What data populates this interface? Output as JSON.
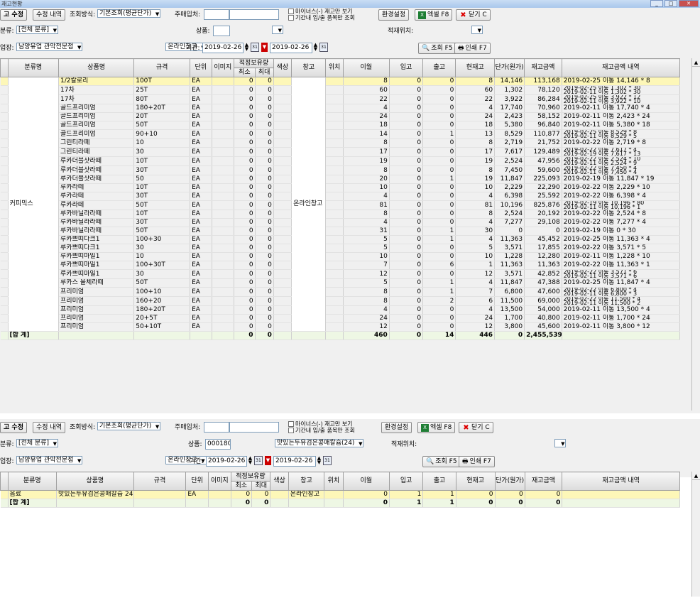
{
  "w1": {
    "title": "재고현황",
    "toolbar": {
      "stock_edit_label": "고 수정",
      "edit_history_label": "수정 내역",
      "query_method_label": "조회방식:",
      "query_method_value": "기본조회(평균단가)",
      "supplier_label": "주매입처:",
      "minus_only_label": "마이너스(-) 재고만 보기",
      "period_io_label": "기간내 입/출 품목만 조회",
      "settings_label": "환경설정",
      "excel_label": "엑셀 F8",
      "close_label": "닫기 C"
    },
    "filter1": {
      "category_label": "분류:",
      "category_value": "[전체 분류]",
      "product_label": "상품:",
      "product_code": "",
      "product_name": "",
      "location_label": "적재위치:",
      "location_value": ""
    },
    "filter2": {
      "store_label": "업장:",
      "store_value": "남양유업 관악전문점",
      "warehouse_value": "온라인창고",
      "period_label": "기간:",
      "date_from": "2019-02-26",
      "date_to": "2019-02-26",
      "search_label": "조회 F5",
      "print_label": "인쇄 F7"
    },
    "columns": [
      "분류명",
      "상품명",
      "규격",
      "단위",
      "이미지",
      "적정보유량",
      "최소",
      "최대",
      "색상",
      "창고",
      "위치",
      "이월",
      "입고",
      "출고",
      "현재고",
      "단가(원가)",
      "재고금액",
      "재고금액 내역"
    ],
    "group_category": "커피믹스",
    "group_warehouse": "온라인창고",
    "rows": [
      {
        "name": "1/2칼로리",
        "spec": "100T",
        "unit": "EA",
        "min": "0",
        "max": "0",
        "prev": "8",
        "in": "0",
        "out": "0",
        "cur": "8",
        "price": "14,146",
        "amount": "113,168",
        "detail": "2019-02-25 이통 14,146 * 8",
        "detail2": ""
      },
      {
        "name": "17차",
        "spec": "25T",
        "unit": "EA",
        "min": "0",
        "max": "0",
        "prev": "60",
        "in": "0",
        "out": "0",
        "cur": "60",
        "price": "1,302",
        "amount": "78,120",
        "detail": "2019-02-25 이통 1,302 * 30",
        "detail2": "2019-02-11 이통 1,302 * 30"
      },
      {
        "name": "17차",
        "spec": "80T",
        "unit": "EA",
        "min": "0",
        "max": "0",
        "prev": "22",
        "in": "0",
        "out": "0",
        "cur": "22",
        "price": "3,922",
        "amount": "86,284",
        "detail": "2019-02-25 이통 3,922 * 12",
        "detail2": "2019-02-11 이통 3,922 * 10"
      },
      {
        "name": "골드프리미엄",
        "spec": "180+20T",
        "unit": "EA",
        "min": "0",
        "max": "0",
        "prev": "4",
        "in": "0",
        "out": "0",
        "cur": "4",
        "price": "17,740",
        "amount": "70,960",
        "detail": "2019-02-11 이통 17,740 * 4",
        "detail2": ""
      },
      {
        "name": "골드프리미엄",
        "spec": "20T",
        "unit": "EA",
        "min": "0",
        "max": "0",
        "prev": "24",
        "in": "0",
        "out": "0",
        "cur": "24",
        "price": "2,423",
        "amount": "58,152",
        "detail": "2019-02-11 이통 2,423 * 24",
        "detail2": ""
      },
      {
        "name": "골드프리미엄",
        "spec": "50T",
        "unit": "EA",
        "min": "0",
        "max": "0",
        "prev": "18",
        "in": "0",
        "out": "0",
        "cur": "18",
        "price": "5,380",
        "amount": "96,840",
        "detail": "2019-02-11 이통 5,380 * 18",
        "detail2": ""
      },
      {
        "name": "골드프리미엄",
        "spec": "90+10",
        "unit": "EA",
        "min": "0",
        "max": "0",
        "prev": "14",
        "in": "0",
        "out": "1",
        "cur": "13",
        "price": "8,529",
        "amount": "110,877",
        "detail": "2019-02-25 이통 8,529 * 8",
        "detail2": "2019-02-11 이통 8,529 * 5"
      },
      {
        "name": "그린티라떼",
        "spec": "10",
        "unit": "EA",
        "min": "0",
        "max": "0",
        "prev": "8",
        "in": "0",
        "out": "0",
        "cur": "8",
        "price": "2,719",
        "amount": "21,752",
        "detail": "2019-02-22 이통 2,719 * 8",
        "detail2": ""
      },
      {
        "name": "그린티라떼",
        "spec": "30",
        "unit": "EA",
        "min": "0",
        "max": "0",
        "prev": "17",
        "in": "0",
        "out": "0",
        "cur": "17",
        "price": "7,617",
        "amount": "129,489",
        "detail": "2019-02-22 이통 7,617 * 4",
        "detail2": "2019-02-19 이통 7,617 * 13"
      },
      {
        "name": "루카더블샷라떼",
        "spec": "10T",
        "unit": "EA",
        "min": "0",
        "max": "0",
        "prev": "19",
        "in": "0",
        "out": "0",
        "cur": "19",
        "price": "2,524",
        "amount": "47,956",
        "detail": "2019-02-22 이통 2,524 * 10",
        "detail2": "2019-02-11 이통 2,524 * 9"
      },
      {
        "name": "루카더블샷라떼",
        "spec": "30T",
        "unit": "EA",
        "min": "0",
        "max": "0",
        "prev": "8",
        "in": "0",
        "out": "0",
        "cur": "8",
        "price": "7,450",
        "amount": "59,600",
        "detail": "2019-02-22 이통 7,450 * 4",
        "detail2": "2019-02-11 이통 7,450 * 4"
      },
      {
        "name": "루카더블샷라떼",
        "spec": "50",
        "unit": "EA",
        "min": "0",
        "max": "0",
        "prev": "20",
        "in": "0",
        "out": "1",
        "cur": "19",
        "price": "11,847",
        "amount": "225,093",
        "detail": "2019-02-19 이통 11,847 * 19",
        "detail2": ""
      },
      {
        "name": "루카라떼",
        "spec": "10T",
        "unit": "EA",
        "min": "0",
        "max": "0",
        "prev": "10",
        "in": "0",
        "out": "0",
        "cur": "10",
        "price": "2,229",
        "amount": "22,290",
        "detail": "2019-02-22 이통 2,229 * 10",
        "detail2": ""
      },
      {
        "name": "루카라떼",
        "spec": "30T",
        "unit": "EA",
        "min": "0",
        "max": "0",
        "prev": "4",
        "in": "0",
        "out": "0",
        "cur": "4",
        "price": "6,398",
        "amount": "25,592",
        "detail": "2019-02-22 이통 6,398 * 4",
        "detail2": ""
      },
      {
        "name": "루카라떼",
        "spec": "50T",
        "unit": "EA",
        "min": "0",
        "max": "0",
        "prev": "81",
        "in": "0",
        "out": "0",
        "cur": "81",
        "price": "10,196",
        "amount": "825,876",
        "detail": "2019-02-19 이통 10,196 * 80",
        "detail2": "2019-02-11 이통 10,196 * 1"
      },
      {
        "name": "루카바닐라라떼",
        "spec": "10T",
        "unit": "EA",
        "min": "0",
        "max": "0",
        "prev": "8",
        "in": "0",
        "out": "0",
        "cur": "8",
        "price": "2,524",
        "amount": "20,192",
        "detail": "2019-02-22 이통 2,524 * 8",
        "detail2": ""
      },
      {
        "name": "루카바닐라라떼",
        "spec": "30T",
        "unit": "EA",
        "min": "0",
        "max": "0",
        "prev": "4",
        "in": "0",
        "out": "0",
        "cur": "4",
        "price": "7,277",
        "amount": "29,108",
        "detail": "2019-02-22 이통 7,277 * 4",
        "detail2": ""
      },
      {
        "name": "루카바닐라라떼",
        "spec": "50T",
        "unit": "EA",
        "min": "0",
        "max": "0",
        "prev": "31",
        "in": "0",
        "out": "1",
        "cur": "30",
        "price": "0",
        "amount": "0",
        "detail": "2019-02-19 이통 0 * 30",
        "detail2": ""
      },
      {
        "name": "루카쁘띠다크1",
        "spec": "100+30",
        "unit": "EA",
        "min": "0",
        "max": "0",
        "prev": "5",
        "in": "0",
        "out": "1",
        "cur": "4",
        "price": "11,363",
        "amount": "45,452",
        "detail": "2019-02-25 이통 11,363 * 4",
        "detail2": ""
      },
      {
        "name": "루카쁘띠다크1",
        "spec": "30",
        "unit": "EA",
        "min": "0",
        "max": "0",
        "prev": "5",
        "in": "0",
        "out": "0",
        "cur": "5",
        "price": "3,571",
        "amount": "17,855",
        "detail": "2019-02-22 이통 3,571 * 5",
        "detail2": ""
      },
      {
        "name": "루카쁘띠마일1",
        "spec": "10",
        "unit": "EA",
        "min": "0",
        "max": "0",
        "prev": "10",
        "in": "0",
        "out": "0",
        "cur": "10",
        "price": "1,228",
        "amount": "12,280",
        "detail": "2019-02-11 이통 1,228 * 10",
        "detail2": ""
      },
      {
        "name": "루카쁘띠마일1",
        "spec": "100+30T",
        "unit": "EA",
        "min": "0",
        "max": "0",
        "prev": "7",
        "in": "0",
        "out": "6",
        "cur": "1",
        "price": "11,363",
        "amount": "11,363",
        "detail": "2019-02-22 이통 11,363 * 1",
        "detail2": ""
      },
      {
        "name": "루카쁘띠마일1",
        "spec": "30",
        "unit": "EA",
        "min": "0",
        "max": "0",
        "prev": "12",
        "in": "0",
        "out": "0",
        "cur": "12",
        "price": "3,571",
        "amount": "42,852",
        "detail": "2019-02-22 이통 3,571 * 6",
        "detail2": "2019-02-11 이통 3,571 * 6"
      },
      {
        "name": "루카스 올체라떼",
        "spec": "50T",
        "unit": "EA",
        "min": "0",
        "max": "0",
        "prev": "5",
        "in": "0",
        "out": "1",
        "cur": "4",
        "price": "11,847",
        "amount": "47,388",
        "detail": "2019-02-25 이통 11,847 * 4",
        "detail2": ""
      },
      {
        "name": "프리미엄",
        "spec": "100+10",
        "unit": "EA",
        "min": "0",
        "max": "0",
        "prev": "8",
        "in": "0",
        "out": "1",
        "cur": "7",
        "price": "6,800",
        "amount": "47,600",
        "detail": "2019-02-22 이통 6,800 * 4",
        "detail2": "2019-02-11 이통 6,800 * 3"
      },
      {
        "name": "프리미엄",
        "spec": "160+20",
        "unit": "EA",
        "min": "0",
        "max": "0",
        "prev": "8",
        "in": "0",
        "out": "2",
        "cur": "6",
        "price": "11,500",
        "amount": "69,000",
        "detail": "2019-02-22 이통 11,500 * 4",
        "detail2": "2019-02-11 이통 11,500 * 2"
      },
      {
        "name": "프리미엄",
        "spec": "180+20T",
        "unit": "EA",
        "min": "0",
        "max": "0",
        "prev": "4",
        "in": "0",
        "out": "0",
        "cur": "4",
        "price": "13,500",
        "amount": "54,000",
        "detail": "2019-02-11 이통 13,500 * 4",
        "detail2": ""
      },
      {
        "name": "프리미엄",
        "spec": "20+5T",
        "unit": "EA",
        "min": "0",
        "max": "0",
        "prev": "24",
        "in": "0",
        "out": "0",
        "cur": "24",
        "price": "1,700",
        "amount": "40,800",
        "detail": "2019-02-11 이통 1,700 * 24",
        "detail2": ""
      },
      {
        "name": "프리미엄",
        "spec": "50+10T",
        "unit": "EA",
        "min": "0",
        "max": "0",
        "prev": "12",
        "in": "0",
        "out": "0",
        "cur": "12",
        "price": "3,800",
        "amount": "45,600",
        "detail": "2019-02-11 이통 3,800 * 12",
        "detail2": ""
      }
    ],
    "total": {
      "label": "[합 계]",
      "min": "0",
      "max": "0",
      "prev": "460",
      "in": "0",
      "out": "14",
      "cur": "446",
      "price": "0",
      "amount": "2,455,539"
    }
  },
  "w2": {
    "toolbar": {
      "stock_edit_label": "고 수정",
      "edit_history_label": "수정 내역",
      "query_method_label": "조회방식:",
      "query_method_value": "기본조회(평균단가)",
      "supplier_label": "주매입처:",
      "minus_only_label": "마이너스(-) 재고만 보기",
      "period_io_label": "기간내 입/출 품목만 조회",
      "settings_label": "환경설정",
      "excel_label": "엑셀 F8",
      "close_label": "닫기 C"
    },
    "filter1": {
      "category_label": "분류:",
      "category_value": "[전체 분류]",
      "product_label": "상품:",
      "product_code": "000180",
      "product_name": "맛있는두유검은콩매칼슘(24)",
      "location_label": "적재위치:",
      "location_value": ""
    },
    "filter2": {
      "store_label": "업장:",
      "store_value": "남양유업 관악전문점",
      "warehouse_value": "온라인창고",
      "period_label": "기간:",
      "date_from": "2019-02-26",
      "date_to": "2019-02-26",
      "search_label": "조회 F5",
      "print_label": "인쇄 F7"
    },
    "row": {
      "category": "음료",
      "name": "맛있는두유검은콩매칼슘 24",
      "spec": "",
      "unit": "EA",
      "min": "0",
      "max": "0",
      "warehouse": "온라인창고",
      "prev": "0",
      "in": "1",
      "out": "1",
      "cur": "0",
      "price": "0",
      "amount": "0",
      "detail": ""
    },
    "total": {
      "label": "[합 계]",
      "min": "0",
      "max": "0",
      "prev": "0",
      "in": "1",
      "out": "1",
      "cur": "0",
      "price": "0",
      "amount": "0"
    }
  },
  "colors": {
    "highlight_row": "#fdf7b8",
    "total_row": "#eef7e4",
    "title_bar": "#b6cfee"
  }
}
